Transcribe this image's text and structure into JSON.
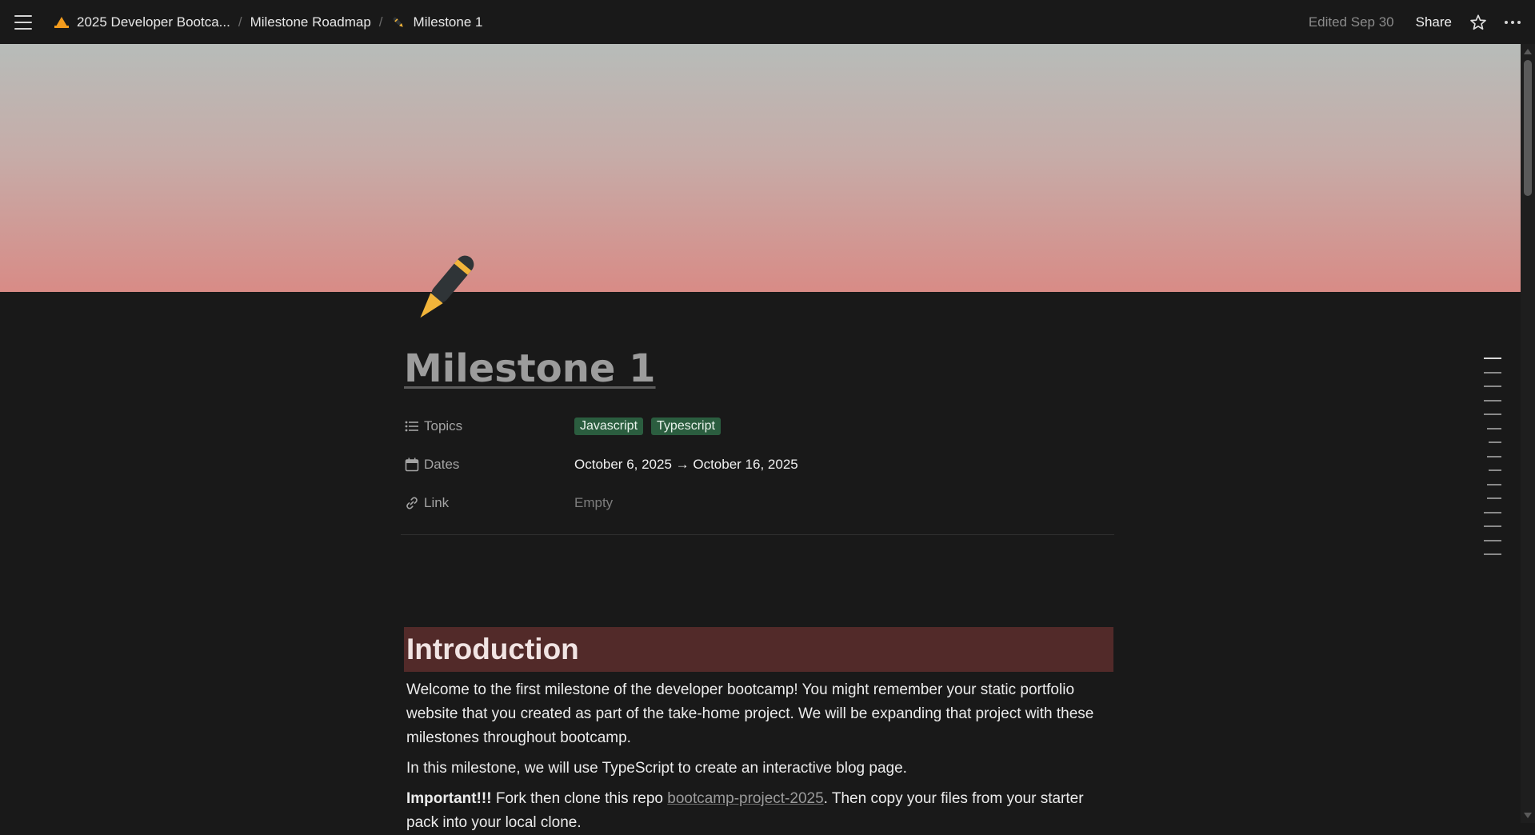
{
  "topbar": {
    "breadcrumbs": [
      {
        "label": "2025 Developer Bootca...",
        "icon": "cone-icon"
      },
      {
        "label": "Milestone Roadmap",
        "icon": ""
      },
      {
        "label": "Milestone 1",
        "icon": "pen-icon"
      }
    ],
    "separator": "/",
    "edited": "Edited Sep 30",
    "share": "Share"
  },
  "page": {
    "title": "Milestone 1",
    "icon": "fountain-pen-icon"
  },
  "properties": {
    "topics": {
      "label": "Topics",
      "tags": [
        "Javascript",
        "Typescript"
      ]
    },
    "dates": {
      "label": "Dates",
      "value": "October 6, 2025 → October 16, 2025"
    },
    "link": {
      "label": "Link",
      "value": "Empty"
    }
  },
  "body": {
    "heading": "Introduction",
    "para1": "Welcome to the first milestone of the developer bootcamp! You might remember your static portfolio website that you created as part of the take-home project. We will be expanding that project with these milestones throughout bootcamp.",
    "para2": "In this milestone, we will use TypeScript to create an interactive blog page.",
    "para3": {
      "bold": "Important!!!",
      "text_before": " Fork then clone this repo ",
      "link": "bootcamp-project-2025",
      "text_after": ". Then copy your files from your starter pack into your local clone."
    }
  },
  "colors": {
    "background": "#191919",
    "tag": "#2b5d3f",
    "heading_bg": "#522a29",
    "cover_top": "#b7bcb9",
    "cover_bottom": "#d88b86"
  }
}
